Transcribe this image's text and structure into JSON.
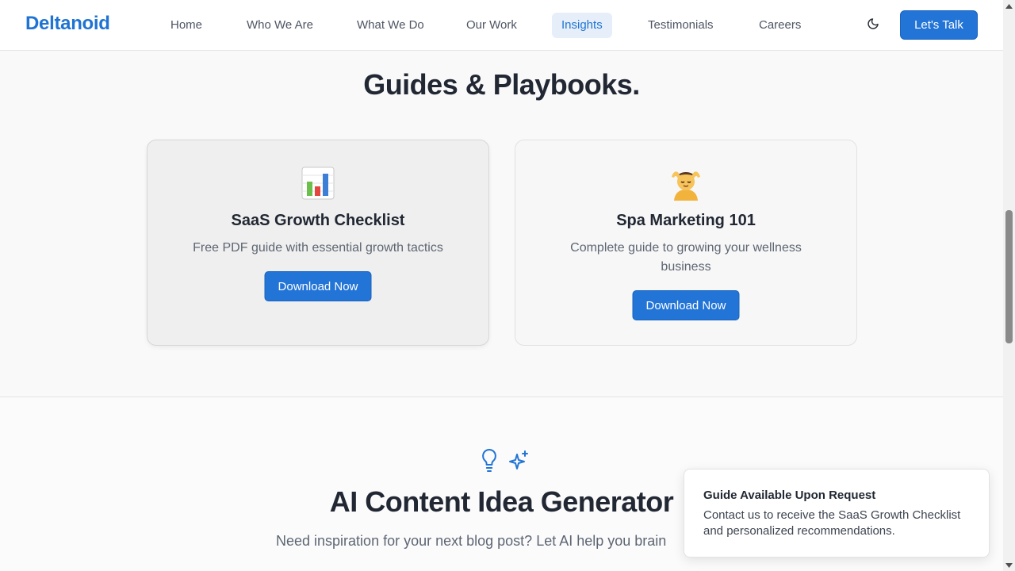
{
  "brand": {
    "name": "Deltanoid",
    "accent": "#1f73d3",
    "button": "#2274d6"
  },
  "nav": {
    "items": [
      {
        "label": "Home"
      },
      {
        "label": "Who We Are"
      },
      {
        "label": "What We Do"
      },
      {
        "label": "Our Work"
      },
      {
        "label": "Insights",
        "active": true
      },
      {
        "label": "Testimonials"
      },
      {
        "label": "Careers"
      }
    ],
    "theme_toggle_icon": "moon-icon",
    "cta_label": "Let's Talk"
  },
  "guides": {
    "title": "Guides & Playbooks.",
    "cards": [
      {
        "icon": "bar-chart-emoji",
        "title": "SaaS Growth Checklist",
        "description": "Free PDF guide with essential growth tactics",
        "button": "Download Now"
      },
      {
        "icon": "person-getting-massage-emoji",
        "title": "Spa Marketing 101",
        "description": "Complete guide to growing your wellness business",
        "button": "Download Now"
      }
    ]
  },
  "ai_generator": {
    "icons": [
      "lightbulb-icon",
      "sparkles-icon"
    ],
    "title": "AI Content Idea Generator",
    "subtitle": "Need inspiration for your next blog post? Let AI help you brain"
  },
  "toast": {
    "title": "Guide Available Upon Request",
    "body": "Contact us to receive the SaaS Growth Checklist and personalized recommendations."
  }
}
